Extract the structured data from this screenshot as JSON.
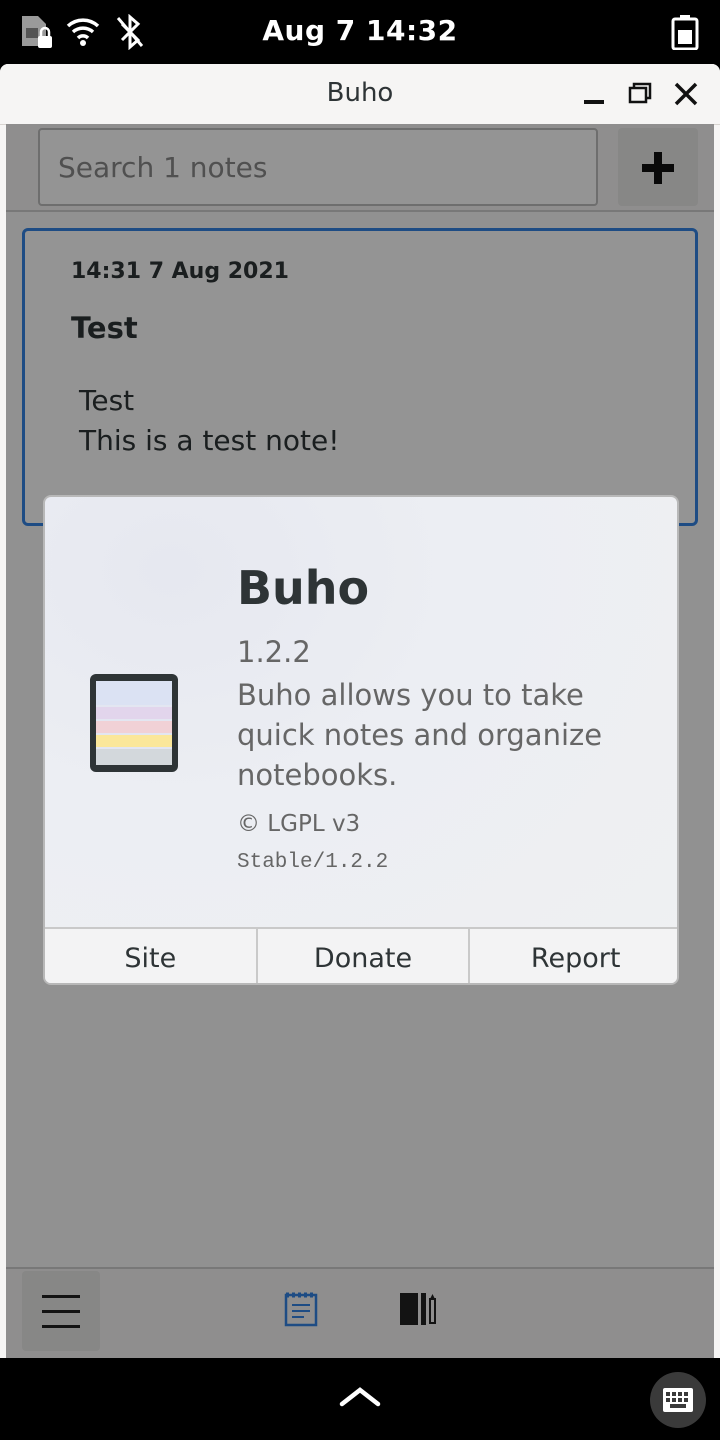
{
  "status_bar": {
    "time": "Aug 7  14:32",
    "icons": [
      "sim-locked-icon",
      "wifi-icon",
      "bluetooth-disabled-icon",
      "battery-icon"
    ]
  },
  "window": {
    "title": "Buho",
    "controls": [
      "minimize-icon",
      "maximize-icon",
      "close-icon"
    ]
  },
  "search": {
    "placeholder": "Search 1 notes",
    "value": ""
  },
  "note": {
    "date": "14:31 7 Aug 2021",
    "title": "Test",
    "body_line1": "Test",
    "body_line2": "This is a test note!"
  },
  "about": {
    "app_name": "Buho",
    "version": "1.2.2",
    "description": "Buho allows you to take quick notes and organize notebooks.",
    "license": "© LGPL v3",
    "build": "Stable/1.2.2",
    "buttons": [
      "Site",
      "Donate",
      "Report"
    ]
  },
  "bottom_bar": {
    "icons": [
      "menu-icon",
      "notes-icon",
      "notebooks-icon"
    ],
    "accent": "#3584e4"
  },
  "nav_bar": {
    "icons": [
      "chevron-up-icon",
      "keyboard-icon"
    ]
  }
}
